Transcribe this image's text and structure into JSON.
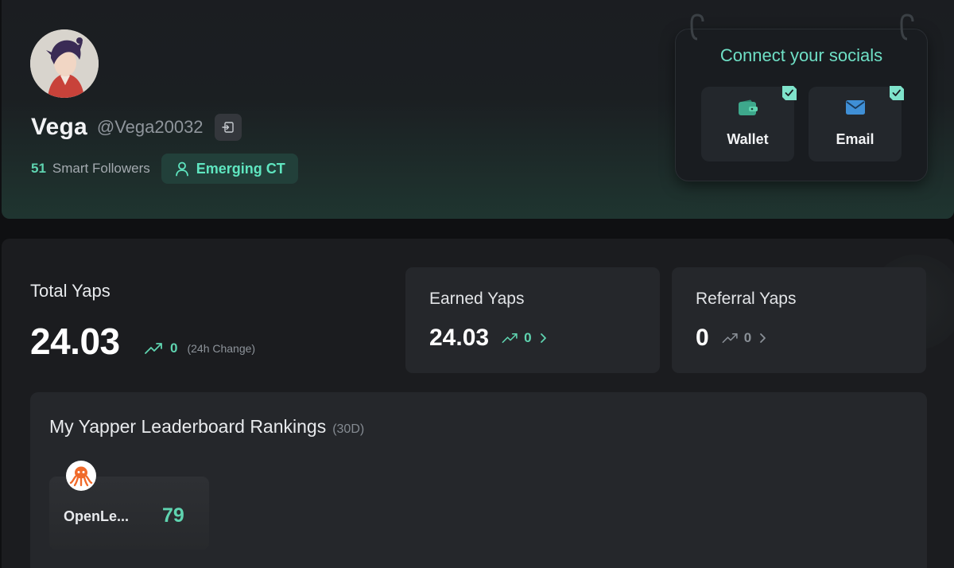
{
  "profile": {
    "name": "Vega",
    "handle": "@Vega20032",
    "smart_followers_count": "51",
    "smart_followers_label": "Smart Followers",
    "badge": "Emerging CT"
  },
  "socials": {
    "title": "Connect your socials",
    "items": [
      {
        "label": "Wallet",
        "icon": "wallet-icon",
        "connected": true
      },
      {
        "label": "Email",
        "icon": "mail-icon",
        "connected": true
      }
    ]
  },
  "stats": {
    "total": {
      "title": "Total Yaps",
      "value": "24.03",
      "change": "0",
      "change_label": "(24h Change)"
    },
    "earned": {
      "title": "Earned Yaps",
      "value": "24.03",
      "change": "0"
    },
    "referral": {
      "title": "Referral Yaps",
      "value": "0",
      "change": "0"
    }
  },
  "rankings": {
    "title": "My Yapper Leaderboard Rankings",
    "period": "(30D)",
    "items": [
      {
        "name": "OpenLe...",
        "score": "79",
        "icon": "octopus-logo-icon"
      }
    ]
  },
  "colors": {
    "accent": "#5fd4b0",
    "background": "#0f1012",
    "card": "#25272b"
  }
}
